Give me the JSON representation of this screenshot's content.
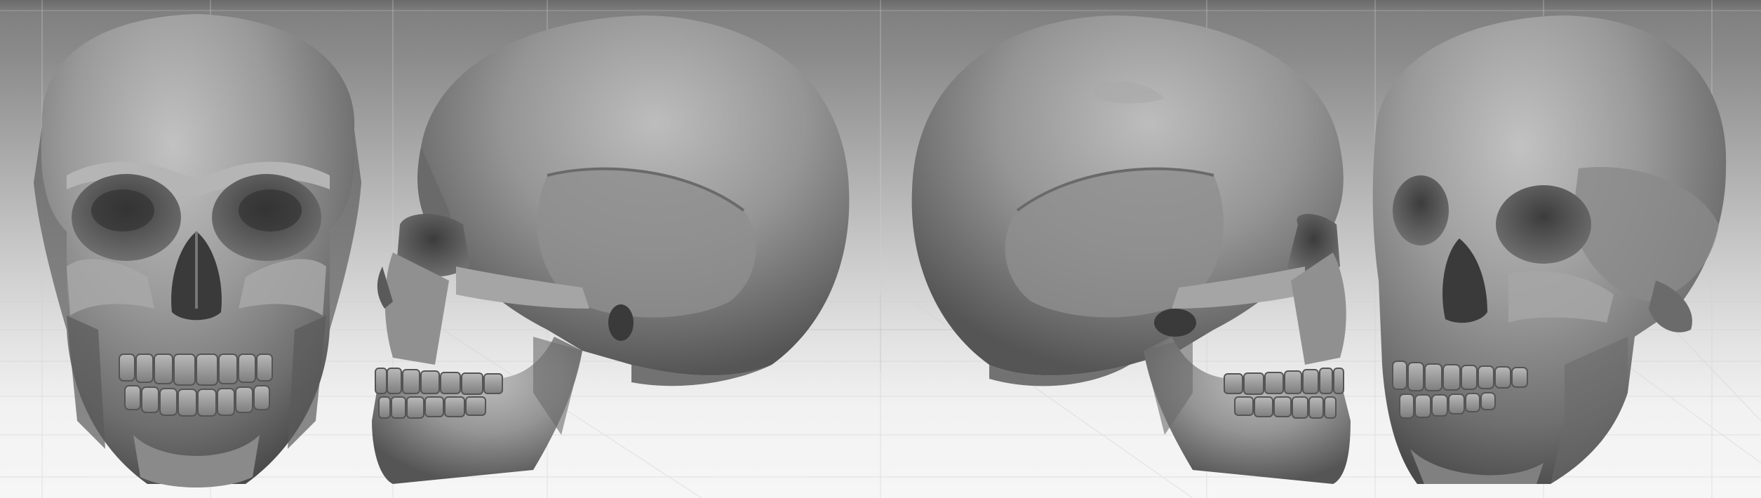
{
  "scene": {
    "background_top": "#7d7d7d",
    "background_bottom": "#f6f6f6",
    "bone_color": "#8f8f8f",
    "views": [
      {
        "name": "front-view"
      },
      {
        "name": "left-side-view"
      },
      {
        "name": "right-side-view"
      },
      {
        "name": "three-quarter-view"
      }
    ]
  }
}
